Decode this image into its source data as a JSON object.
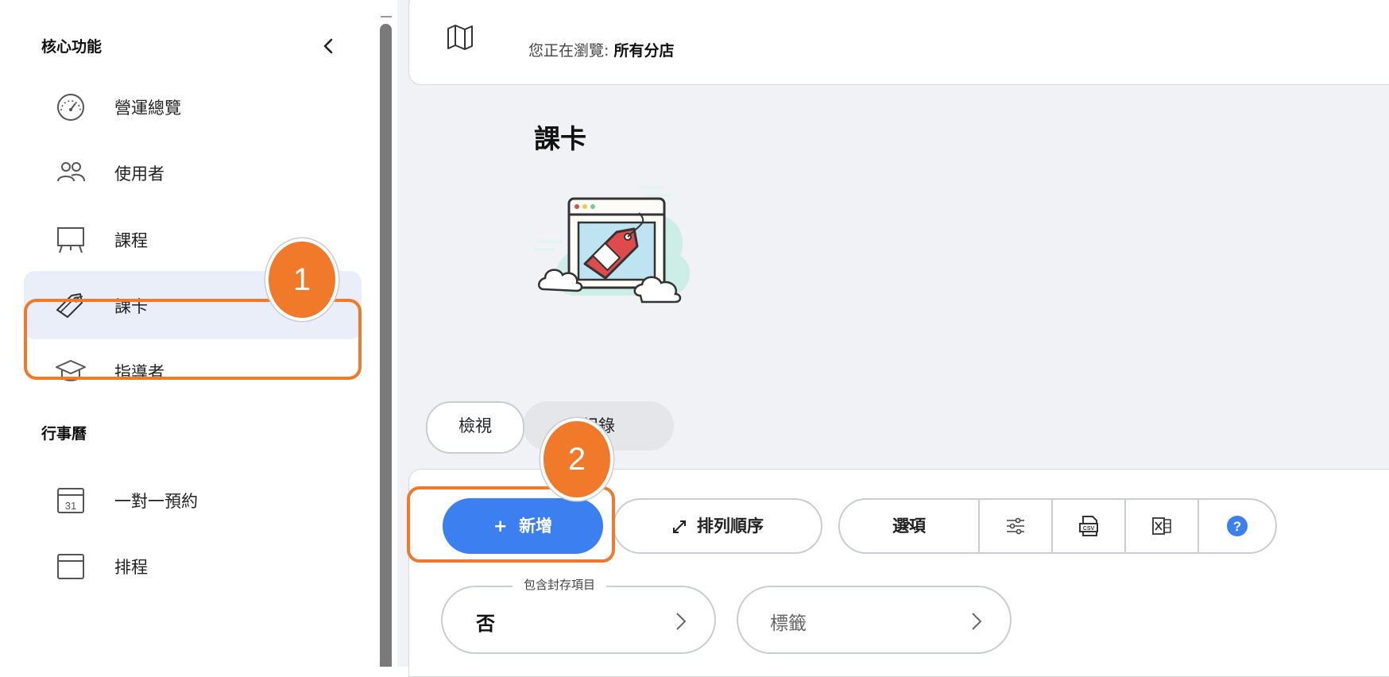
{
  "sidebar": {
    "section_core": "核心功能",
    "section_calendar": "行事曆",
    "items": [
      {
        "label": "營運總覽",
        "icon": "dashboard-gauge-icon"
      },
      {
        "label": "使用者",
        "icon": "users-icon"
      },
      {
        "label": "課程",
        "icon": "easel-board-icon"
      },
      {
        "label": "課卡",
        "icon": "price-tag-icon"
      },
      {
        "label": "指導者",
        "icon": "graduation-cap-icon"
      }
    ],
    "calendar_items": [
      {
        "label": "一對一預約",
        "icon": "calendar-31-icon",
        "day": "31"
      },
      {
        "label": "排程",
        "icon": "calendar-icon"
      }
    ]
  },
  "topbar": {
    "browse_prefix": "您正在瀏覽:",
    "browse_scope": "所有分店"
  },
  "page": {
    "title": "課卡"
  },
  "tabs": {
    "view": "檢視",
    "log": "紀錄"
  },
  "toolbar": {
    "add_plus": "+",
    "add_label": "新增",
    "sort_label": "排列順序",
    "options_label": "選項",
    "help_glyph": "?"
  },
  "filters": {
    "archived_legend": "包含封存項目",
    "archived_value": "否",
    "tags_placeholder": "標籤"
  },
  "annotations": {
    "step1": "1",
    "step2": "2"
  },
  "colors": {
    "accent": "#3c7ff0",
    "highlight": "#f07a2a",
    "active_bg": "#e9eef9"
  }
}
